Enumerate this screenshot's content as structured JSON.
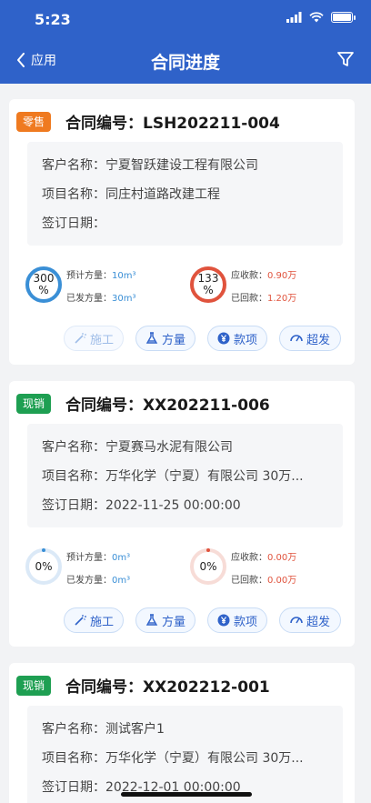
{
  "status_bar": {
    "time": "5:23"
  },
  "nav": {
    "back_label": "应用",
    "title": "合同进度"
  },
  "contracts": [
    {
      "badge": "零售",
      "title": "合同编号：LSH202211-004",
      "customer": "客户名称：宁夏智跃建设工程有限公司",
      "project": "项目名称：同庄村道路改建工程",
      "sign_date": "签订日期：",
      "volume_percent": "300\n%",
      "volume_progress": 1.0,
      "planned_volume_label": "预计方量：",
      "planned_volume": "10m³",
      "sent_volume_label": "已发方量：",
      "sent_volume": "30m³",
      "payment_percent": "133\n%",
      "payment_progress": 1.0,
      "receivable_label": "应收款：",
      "receivable": "0.90万",
      "received_label": "已回款：",
      "received": "1.20万"
    },
    {
      "badge": "现销",
      "title": "合同编号：XX202211-006",
      "customer": "客户名称：宁夏赛马水泥有限公司",
      "project": "项目名称：万华化学（宁夏）有限公司 30万...",
      "sign_date": "签订日期：2022-11-25 00:00:00",
      "volume_percent": "0%",
      "volume_progress": 0,
      "planned_volume_label": "预计方量：",
      "planned_volume": "0m³",
      "sent_volume_label": "已发方量：",
      "sent_volume": "0m³",
      "payment_percent": "0%",
      "payment_progress": 0,
      "receivable_label": "应收款：",
      "receivable": "0.00万",
      "received_label": "已回款：",
      "received": "0.00万"
    },
    {
      "badge": "现销",
      "title": "合同编号：XX202212-001",
      "customer": "客户名称：测试客户1",
      "project": "项目名称：万华化学（宁夏）有限公司 30万...",
      "sign_date": "签订日期：2022-12-01 00:00:00"
    }
  ],
  "buttons": {
    "construction": "施工",
    "volume": "方量",
    "payment": "款项",
    "over_send": "超发"
  },
  "colors": {
    "header": "#2f62c9",
    "retail_badge": "#ef7a20",
    "cash_badge": "#1e9f52",
    "volume_ring": "#3a8fd6",
    "payment_ring": "#e0533d"
  }
}
